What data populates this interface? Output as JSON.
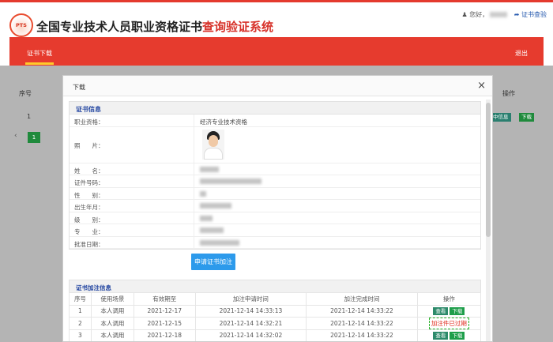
{
  "site": {
    "logo_text": "PTS",
    "title_main": "全国专业技术人员职业资格证书",
    "title_highlight": "查询验证系统",
    "greeting": "您好，",
    "verify_link": "证书查验",
    "nav_tab": "证书下载",
    "nav_exit": "退出"
  },
  "background": {
    "col_no": "序号",
    "col_op": "操作",
    "row_no": "1",
    "btn_view": "中信息",
    "btn_dl": "下载",
    "page": "1"
  },
  "modal": {
    "title": "下载",
    "close": "×",
    "info_title": "证书信息",
    "rows": [
      {
        "label": "职业资格：",
        "value": "经济专业技术资格"
      },
      {
        "label": "照　　片：",
        "value": ""
      },
      {
        "label": "姓　　名：",
        "value": ""
      },
      {
        "label": "证件号码：",
        "value": ""
      },
      {
        "label": "性　　别：",
        "value": ""
      },
      {
        "label": "出生年月：",
        "value": ""
      },
      {
        "label": "级　　别：",
        "value": ""
      },
      {
        "label": "专　　业：",
        "value": ""
      },
      {
        "label": "批准日期：",
        "value": ""
      }
    ],
    "apply_button": "申请证书加注",
    "annot_title": "证书加注信息",
    "table_headers": [
      "序号",
      "使用场景",
      "有效期至",
      "加注申请时间",
      "加注完成时间",
      "操作"
    ],
    "table_rows": [
      {
        "no": "1",
        "scene": "本人调用",
        "valid": "2021-12-17",
        "apply": "2021-12-14 14:33:13",
        "done": "2021-12-14 14:33:22",
        "op": "buttons"
      },
      {
        "no": "2",
        "scene": "本人调用",
        "valid": "2021-12-15",
        "apply": "2021-12-14 14:32:21",
        "done": "2021-12-14 14:33:22",
        "op": "expired"
      },
      {
        "no": "3",
        "scene": "本人调用",
        "valid": "2021-12-18",
        "apply": "2021-12-14 14:32:02",
        "done": "2021-12-14 14:33:22",
        "op": "buttons"
      }
    ],
    "op_view": "查看",
    "op_dl": "下载",
    "op_expired": "加注件已过期"
  },
  "colors": {
    "brand_red": "#e63b2e",
    "accent_blue": "#2d9aeb",
    "link_blue": "#2144a0"
  }
}
